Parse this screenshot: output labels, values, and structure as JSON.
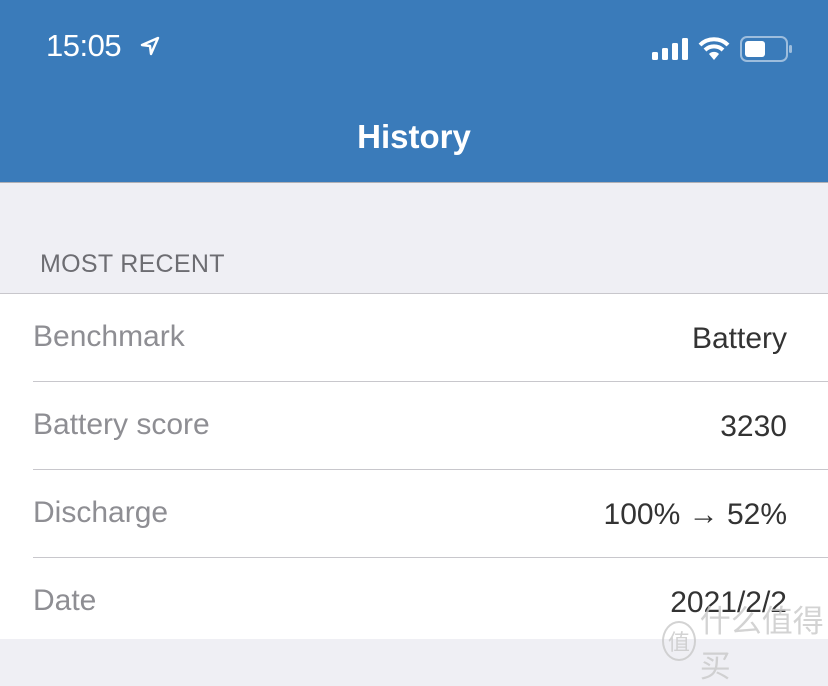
{
  "status_bar": {
    "time": "15:05",
    "icons": [
      "location-arrow-icon",
      "signal-icon",
      "wifi-icon",
      "battery-icon"
    ]
  },
  "header": {
    "title": "History",
    "color": "#3a7bba"
  },
  "section": {
    "title": "MOST RECENT"
  },
  "rows": [
    {
      "label": "Benchmark",
      "value": "Battery"
    },
    {
      "label": "Battery score",
      "value": "3230"
    },
    {
      "label": "Discharge",
      "value": "100% → 52%"
    },
    {
      "label": "Date",
      "value": "2021/2/2"
    }
  ],
  "watermark": {
    "logo": "值",
    "text": "什么值得买"
  }
}
